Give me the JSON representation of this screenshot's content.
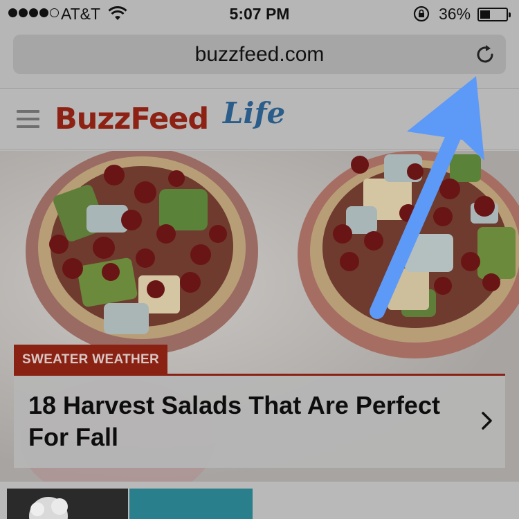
{
  "status_bar": {
    "carrier": "AT&T",
    "time": "5:07 PM",
    "battery_percent": "36%",
    "signal_bars_filled": 4,
    "signal_bars_total": 5
  },
  "browser": {
    "url": "buzzfeed.com",
    "reload_icon": "reload-icon"
  },
  "site": {
    "menu_icon": "hamburger-menu-icon",
    "logo_main": "BuzzFeed",
    "logo_section": "Life"
  },
  "hero": {
    "category": "SWEATER WEATHER",
    "headline": "18 Harvest Salads That Are Perfect For Fall",
    "chevron_icon": "chevron-right-icon"
  },
  "colors": {
    "buzzfeed_red": "#8d2214",
    "life_blue": "#2a5d8a",
    "annotation_arrow": "#5d9af7"
  }
}
